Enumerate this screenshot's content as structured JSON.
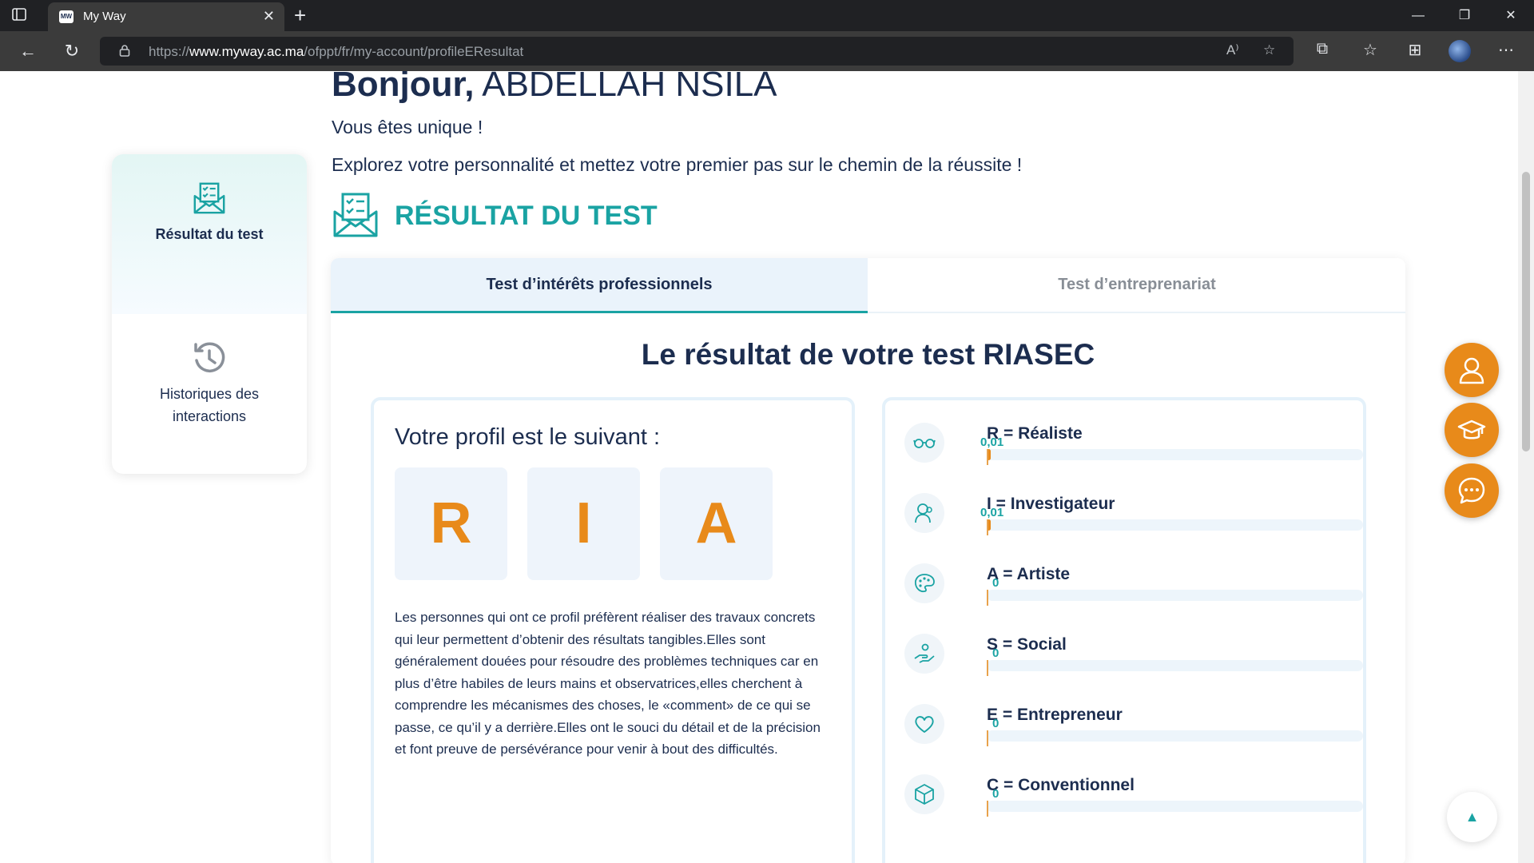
{
  "browser": {
    "tab_title": "My Way",
    "url_prefix": "https://",
    "url_domain": "www.myway.ac.ma",
    "url_path": "/ofppt/fr/my-account/profileEResultat"
  },
  "header": {
    "greeting_hello": "Bonjour,",
    "greeting_name": " ABDELLAH NSILA",
    "unique": "Vous êtes unique !",
    "explore": "Explorez votre personnalité et mettez votre premier pas sur le chemin de la réussite !",
    "section_title": "RÉSULTAT DU TEST"
  },
  "sidebar": {
    "items": [
      {
        "label": "Résultat du test",
        "icon": "envelope-checklist-icon",
        "active": true
      },
      {
        "label": "Historiques des interactions",
        "icon": "history-clock-icon",
        "active": false
      }
    ]
  },
  "tabs": [
    {
      "label": "Test d’intérêts professionnels",
      "active": true
    },
    {
      "label": "Test d’entreprenariat",
      "active": false
    }
  ],
  "result": {
    "title": "Le résultat de votre test RIASEC",
    "profile_heading": "Votre profil est le suivant :",
    "letters": [
      "R",
      "I",
      "A"
    ],
    "description": "Les personnes qui ont ce profil préfèrent réaliser des travaux concrets qui leur permettent d’obtenir des résultats tangibles.Elles sont généralement douées pour résoudre des problèmes techniques car en plus d’être habiles de leurs mains et observatrices,elles cherchent à comprendre les mécanismes des choses, le «comment» de ce qui se passe, ce qu’il y a derrière.Elles ont le souci du détail et de la précision et font preuve de persévérance pour venir à bout des difficultés."
  },
  "scores": [
    {
      "label": "R = Réaliste",
      "value": "0,01",
      "fraction": 0.01,
      "icon": "glasses-icon"
    },
    {
      "label": "I = Investigateur",
      "value": "0,01",
      "fraction": 0.01,
      "icon": "scientist-icon"
    },
    {
      "label": "A = Artiste",
      "value": "0",
      "fraction": 0,
      "icon": "palette-icon"
    },
    {
      "label": "S = Social",
      "value": "0",
      "fraction": 0,
      "icon": "helping-hand-icon"
    },
    {
      "label": "E = Entrepreneur",
      "value": "0",
      "fraction": 0,
      "icon": "heart-icon"
    },
    {
      "label": "C = Conventionnel",
      "value": "0",
      "fraction": 0,
      "icon": "cube-icon"
    }
  ],
  "colors": {
    "accent_teal": "#1aa3a3",
    "accent_orange": "#e88a1a",
    "navy": "#1c2d4f"
  }
}
